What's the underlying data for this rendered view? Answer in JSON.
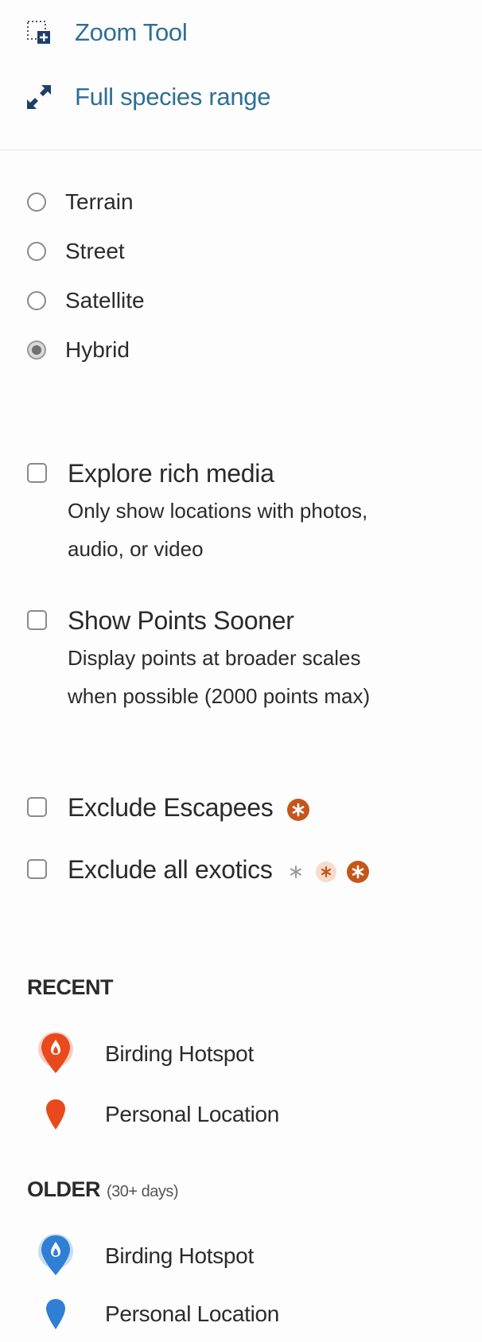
{
  "tools": {
    "zoom_label": "Zoom Tool",
    "range_label": "Full species range"
  },
  "map_types": [
    {
      "label": "Terrain",
      "selected": false
    },
    {
      "label": "Street",
      "selected": false
    },
    {
      "label": "Satellite",
      "selected": false
    },
    {
      "label": "Hybrid",
      "selected": true
    }
  ],
  "options": {
    "rich_media": {
      "title": "Explore rich media",
      "description": "Only show locations with photos, audio, or video"
    },
    "points_sooner": {
      "title": "Show Points Sooner",
      "description": "Display points at broader scales when possible (2000 points max)"
    },
    "escapees": {
      "title": "Exclude Escapees"
    },
    "exotics": {
      "title": "Exclude all exotics"
    }
  },
  "legend": {
    "recent": {
      "heading": "RECENT",
      "hotspot_label": "Birding Hotspot",
      "personal_label": "Personal Location"
    },
    "older": {
      "heading": "OLDER",
      "subheading": "(30+ days)",
      "hotspot_label": "Birding Hotspot",
      "personal_label": "Personal Location"
    }
  },
  "colors": {
    "link": "#2e6f95",
    "recent_marker": "#e8491d",
    "older_marker": "#2f7fd4",
    "exotic_orange": "#c5561a"
  },
  "icons": {
    "zoom": "zoom-tool-icon",
    "range": "expand-icon",
    "exotic": "asterisk-badge-icon"
  }
}
